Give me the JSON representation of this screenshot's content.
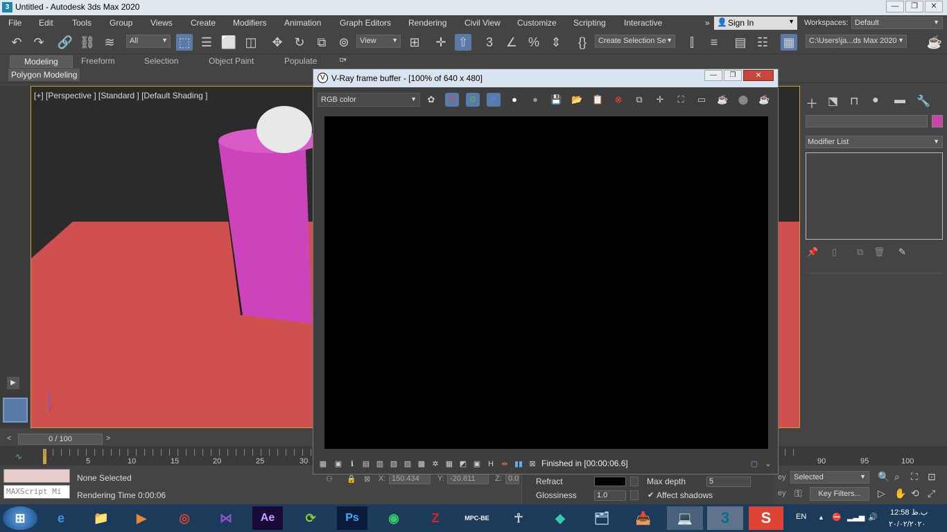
{
  "window": {
    "title": "Untitled - Autodesk 3ds Max 2020",
    "app_icon": "3"
  },
  "menu": [
    "File",
    "Edit",
    "Tools",
    "Group",
    "Views",
    "Create",
    "Modifiers",
    "Animation",
    "Graph Editors",
    "Rendering",
    "Civil View",
    "Customize",
    "Scripting",
    "Interactive"
  ],
  "menu_more": "»",
  "signin": "Sign In",
  "workspaces": {
    "label": "Workspaces:",
    "value": "Default"
  },
  "toolbar": {
    "filter_value": "All",
    "view_value": "View",
    "selection_set": "Create Selection Se",
    "path": "C:\\Users\\ja...ds Max 2020"
  },
  "ribbon": {
    "tabs": [
      "Modeling",
      "Freeform",
      "Selection",
      "Object Paint",
      "Populate"
    ],
    "active": "Modeling",
    "sub": "Polygon Modeling"
  },
  "viewport": {
    "label": "[+] [Perspective ] [Standard ] [Default Shading ]"
  },
  "command_panel": {
    "modifier_list": "Modifier List"
  },
  "vfb": {
    "title": "V-Ray frame buffer - [100% of 640 x 480]",
    "title_icon": "V",
    "channel": "RGB color",
    "channel_r": "R",
    "channel_g": "G",
    "channel_b": "B",
    "status": "Finished in [00:00:06.6]"
  },
  "timeline": {
    "counter": "0 / 100",
    "ticks": [
      "5",
      "10",
      "15",
      "20",
      "25",
      "30",
      "90",
      "95",
      "100"
    ]
  },
  "status": {
    "selection": "None Selected",
    "render_time_label": "Rendering Time  0:00:06",
    "maxscript": "MAXScript Mi",
    "x_label": "X:",
    "x_value": "150.434",
    "y_label": "Y:",
    "y_value": "-20.611",
    "z_label": "Z:",
    "z_value": "0.0",
    "refract": "Refract",
    "glossiness": "Glossiness",
    "glossiness_value": "1.0",
    "max_depth": "Max depth",
    "max_depth_value": "5",
    "affect_shadows": "Affect shadows",
    "selected_value": "Selected",
    "key_filters": "Key Filters...",
    "key_label_1": "ey",
    "key_label_2": "ey"
  },
  "taskbar": {
    "ae": "Ae",
    "ps": "Ps",
    "max": "3",
    "lang": "EN",
    "time": "12:58 ب.ظ",
    "date": "۲۰/۰۲/۲۰۲۰",
    "mpc": "MPC-BE"
  },
  "colors": {
    "pink": "#cc44bb",
    "floor": "#d05050",
    "accent": "#c8a23c"
  }
}
